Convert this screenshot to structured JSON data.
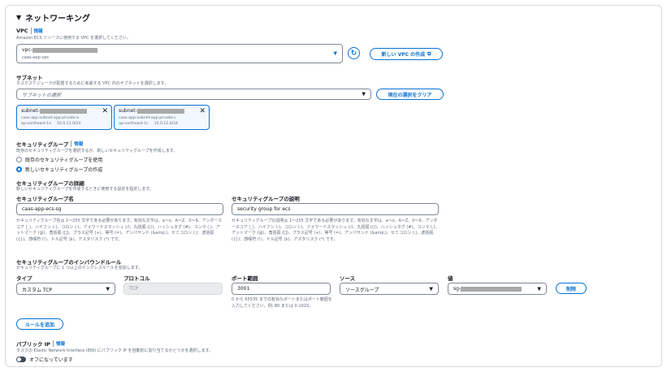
{
  "section": {
    "title": "ネットワーキング"
  },
  "vpc": {
    "label": "VPC",
    "info": "情報",
    "desc": "Amazon ECS リソースに使用する VPC を選択してください。",
    "value_prefix": "vpc-",
    "value_sub": "caas-app-vpc",
    "refresh_icon": "refresh-icon",
    "create_button": "新しい VPC の作成",
    "external_icon": "external-link-icon"
  },
  "subnet": {
    "label": "サブネット",
    "desc": "タスクスケジューラが配置するために考慮する VPC 内のサブネットを選択します。",
    "placeholder": "サブネットの選択",
    "clear_button": "現在の選択をクリア",
    "tokens": [
      {
        "id_prefix": "subnet-",
        "name": "caas-app-subnet-app-private-a",
        "az": "ap-northeast-1a",
        "cidr": "10.0.11.0/24"
      },
      {
        "id_prefix": "subnet-",
        "name": "caas-app-subnet-app-private-c",
        "az": "ap-northeast-1c",
        "cidr": "10.0.12.0/24"
      }
    ]
  },
  "security_group": {
    "label": "セキュリティグループ",
    "info": "情報",
    "desc": "既存のセキュリティグループを選択するか、新しいセキュリティグループを作成します。",
    "option_existing": "既存のセキュリティグループを使用",
    "option_new": "新しいセキュリティグループの作成",
    "selected": "new"
  },
  "sg_details": {
    "label": "セキュリティグループの詳細",
    "desc": "新しいセキュリティグループを作成するときに使用する設定を指定します。",
    "name_label": "セキュリティグループ名",
    "name_value": "caas-app-ecs-sg",
    "name_hint": "セキュリティグループ名は 1〜255 文字である必要があります。有効な文字は、a〜z、A〜Z、0〜9、アンダースコア (_)、ハイフン (-)、コロン (:)、フォワードスラッシュ (/)、丸括弧 (())、ハッシュタグ (#)、コンマ (,)、アットマーク (@)、角括弧 ([])、プラス記号 (+)、等号 (=)、アンパサンド (&amp;)、セミコロン (;)、波括弧 ({})、感嘆符 (!)、ドル記号 ($)、アスタリスク (*) です。",
    "desc_label": "セキュリティグループの説明",
    "desc_value": "security group for ecs",
    "desc_hint": "セキュリティグループの説明は 1〜255 文字である必要があります。有効な文字は、a〜z、A〜Z、0〜9、アンダースコア (_)、ハイフン (-)、コロン (:)、フォワードスラッシュ (/)、丸括弧 (())、ハッシュタグ (#)、コンマ (,)、アットマーク (@)、角括弧 ([])、プラス記号 (+)、等号 (=)、アンパサンド (&amp;)、セミコロン (;)、波括弧 ({})、感嘆符 (!)、ドル記号 ($)、アスタリスク (*) です。"
  },
  "inbound": {
    "label": "セキュリティグループのインバウンドルール",
    "desc": "セキュリティグループに 1 つ以上のイングレスルールを追加します。",
    "col_type": "タイプ",
    "col_protocol": "プロトコル",
    "col_port": "ポート範囲",
    "col_source": "ソース",
    "col_value": "値",
    "type_value": "カスタム TCP",
    "protocol_value": "TCP",
    "port_value": "3001",
    "port_hint": "0 から 65535 までの有効なポートまたはポート範囲を入力してください。例: 80 または 0-1023。",
    "source_value": "ソースグループ",
    "value_prefix": "sg-",
    "delete_button": "削除",
    "add_rule_button": "ルールを追加"
  },
  "public_ip": {
    "label": "パブリック IP",
    "info": "情報",
    "desc": "タスクの Elastic Network Interface (ENI) にパブリック IP を自動的に割り当てるかどうかを選択します。",
    "toggle_label": "オフになっています"
  }
}
